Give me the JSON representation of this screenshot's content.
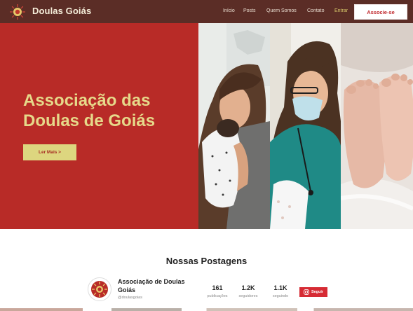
{
  "header": {
    "brand": "Doulas Goiás",
    "logo_icon": "sun-logo-icon",
    "nav": [
      "Início",
      "Posts",
      "Quem Somos",
      "Contato"
    ],
    "login": "Entrar",
    "join": "Associe-se"
  },
  "hero": {
    "title_line1": "Associação das",
    "title_line2": "Doulas de Goiás",
    "cta": "Ler Mais >"
  },
  "posts": {
    "title": "Nossas Postagens",
    "profile_name": "Associação de Doulas Goiás",
    "handle": "@doulasgoias",
    "stats": [
      {
        "value": "161",
        "label": "publicações"
      },
      {
        "value": "1.2K",
        "label": "seguidores"
      },
      {
        "value": "1.1K",
        "label": "seguindo"
      }
    ],
    "follow": "Seguir",
    "follow_icon": "instagram-icon"
  },
  "colors": {
    "header_bg": "#5b2d26",
    "hero_red": "#b82b27",
    "hero_title": "#e6d98a",
    "cta_bg": "#ddd67f",
    "follow_bg": "#d62b34"
  }
}
